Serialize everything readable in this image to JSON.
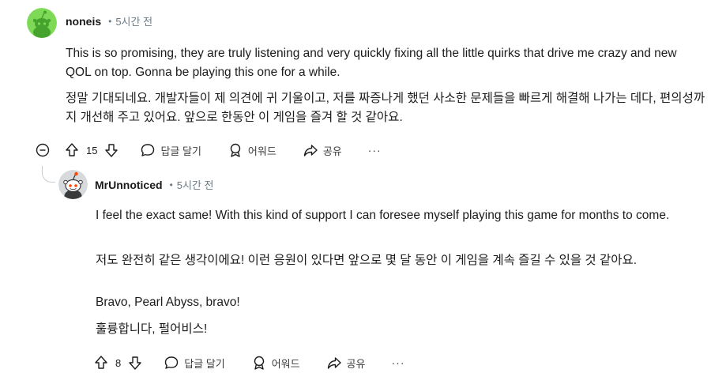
{
  "comments": [
    {
      "username": "noneis",
      "dot": "•",
      "time": "5시간 전",
      "body_en": "This is so promising, they are truly listening and very quickly fixing all the little quirks that drive me crazy and new QOL on top. Gonna be playing this one for a while.",
      "body_ko": "정말 기대되네요. 개발자들이 제 의견에 귀 기울이고, 저를 짜증나게 했던 사소한 문제들을 빠르게 해결해 나가는 데다, 편의성까지 개선해 주고 있어요. 앞으로 한동안 이 게임을 즐겨 할 것 같아요.",
      "score": "15",
      "reply_label": "답글 달기",
      "award_label": "어워드",
      "share_label": "공유",
      "more_label": "···"
    },
    {
      "username": "MrUnnoticed",
      "dot": "•",
      "time": "5시간 전",
      "body_en": "I feel the exact same! With this kind of support I can foresee myself playing this game for months to come.",
      "body_ko": "저도 완전히 같은 생각이에요! 이런 응원이 있다면 앞으로 몇 달 동안 이 게임을 계속 즐길 수 있을 것 같아요.",
      "bravo_en": "Bravo, Pearl Abyss, bravo!",
      "bravo_ko": "훌륭합니다, 펄어비스!",
      "score": "8",
      "reply_label": "답글 달기",
      "award_label": "어워드",
      "share_label": "공유",
      "more_label": "···"
    }
  ],
  "icons": {
    "collapse": "minus-circle-icon",
    "upvote": "arrow-up-icon",
    "downvote": "arrow-down-icon",
    "reply": "speech-bubble-icon",
    "award": "award-icon",
    "share": "share-arrow-icon",
    "more": "ellipsis-icon"
  },
  "colors": {
    "avatar1_bg": "#7ed957",
    "avatar2_bg": "#d7dadc",
    "meta_text": "#6b7a85",
    "thread_line": "#c7ced3"
  }
}
